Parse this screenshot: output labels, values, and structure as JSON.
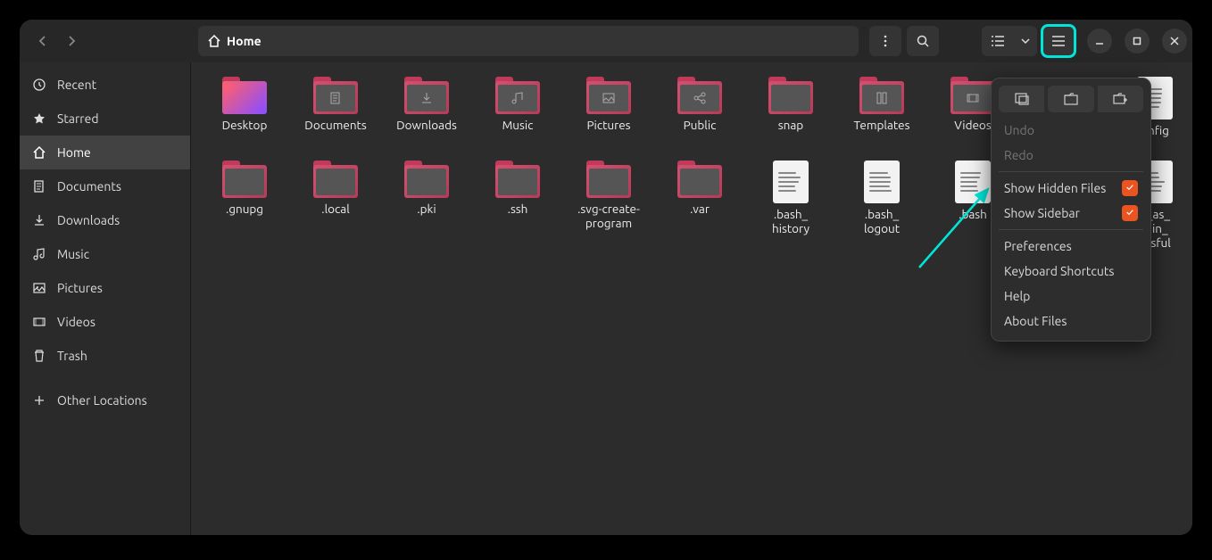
{
  "path": {
    "label": "Home"
  },
  "sidebar": {
    "items": [
      {
        "label": "Recent"
      },
      {
        "label": "Starred"
      },
      {
        "label": "Home"
      },
      {
        "label": "Documents"
      },
      {
        "label": "Downloads"
      },
      {
        "label": "Music"
      },
      {
        "label": "Pictures"
      },
      {
        "label": "Videos"
      },
      {
        "label": "Trash"
      },
      {
        "label": "Other Locations"
      }
    ]
  },
  "files": [
    {
      "name": "Desktop",
      "type": "folder-gradient"
    },
    {
      "name": "Documents",
      "type": "folder",
      "icon": "doc"
    },
    {
      "name": "Downloads",
      "type": "folder",
      "icon": "down"
    },
    {
      "name": "Music",
      "type": "folder",
      "icon": "music"
    },
    {
      "name": "Pictures",
      "type": "folder",
      "icon": "pic"
    },
    {
      "name": "Public",
      "type": "folder",
      "icon": "share"
    },
    {
      "name": "snap",
      "type": "folder"
    },
    {
      "name": "Templates",
      "type": "folder",
      "icon": "tmpl"
    },
    {
      "name": "Videos",
      "type": "folder",
      "icon": "vid"
    },
    {
      "name": "",
      "type": "blank"
    },
    {
      "name": "onfig",
      "type": "file-partial"
    },
    {
      "name": ".gnupg",
      "type": "folder"
    },
    {
      "name": ".local",
      "type": "folder"
    },
    {
      "name": ".pki",
      "type": "folder"
    },
    {
      "name": ".ssh",
      "type": "folder"
    },
    {
      "name": ".svg-create-program",
      "type": "folder"
    },
    {
      "name": ".var",
      "type": "folder"
    },
    {
      "name": ".bash_\nhistory",
      "type": "file"
    },
    {
      "name": ".bash_\nlogout",
      "type": "file"
    },
    {
      "name": ".bash",
      "type": "file-partial"
    },
    {
      "name": "",
      "type": "blank"
    },
    {
      "name": "o_as_\nmin_\nessful",
      "type": "file-partial"
    }
  ],
  "menu": {
    "undo": "Undo",
    "redo": "Redo",
    "show_hidden": "Show Hidden Files",
    "show_sidebar": "Show Sidebar",
    "preferences": "Preferences",
    "shortcuts": "Keyboard Shortcuts",
    "help": "Help",
    "about": "About Files"
  }
}
